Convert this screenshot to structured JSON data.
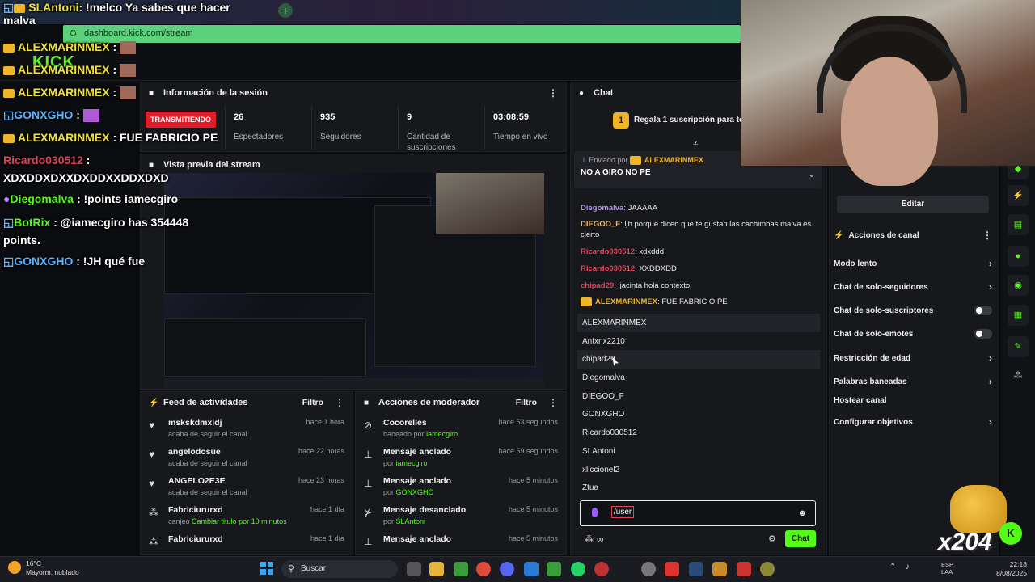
{
  "browser": {
    "url": "dashboard.kick.com/stream",
    "new_tab": "+"
  },
  "kick": {
    "logo": "KICK"
  },
  "session": {
    "title": "Información de la sesión",
    "live_badge": "TRANSMITIENDO",
    "stats": [
      {
        "value": "26",
        "label": "Espectadores"
      },
      {
        "value": "935",
        "label": "Seguidores"
      },
      {
        "value": "9",
        "label": "Cantidad de suscripciones"
      },
      {
        "value": "03:08:59",
        "label": "Tiempo en vivo"
      }
    ]
  },
  "preview": {
    "title": "Vista previa del stream"
  },
  "feed": {
    "title": "Feed de actividades",
    "filter": "Filtro",
    "items": [
      {
        "icon": "heart-icon",
        "name": "mskskdmxidj",
        "detail": "acaba de seguir el canal",
        "time": "hace 1 hora"
      },
      {
        "icon": "heart-icon",
        "name": "angelodosue",
        "detail": "acaba de seguir el canal",
        "time": "hace 22 horas"
      },
      {
        "icon": "heart-icon",
        "name": "ANGELO2E3E",
        "detail": "acaba de seguir el canal",
        "time": "hace 23 horas"
      },
      {
        "icon": "points-icon",
        "name": "Fabriciururxd",
        "detail_prefix": "canjeó",
        "detail_hl": "Cambiar titulo por 10 minutos",
        "time": "hace 1 día"
      },
      {
        "icon": "points-icon",
        "name": "Fabriciururxd",
        "detail": "",
        "time": "hace 1 día"
      }
    ]
  },
  "mod": {
    "title": "Acciones de moderador",
    "filter": "Filtro",
    "items": [
      {
        "icon": "ban-icon",
        "name": "Cocorelles",
        "prefix": "baneado por",
        "by": "iamecgiro",
        "time": "hace 53 segundos"
      },
      {
        "icon": "pin-icon",
        "name": "Mensaje anclado",
        "prefix": "por",
        "by": "iamecgiro",
        "time": "hace 59 segundos"
      },
      {
        "icon": "pin-icon",
        "name": "Mensaje anclado",
        "prefix": "por",
        "by": "GONXGHO",
        "time": "hace 5 minutos"
      },
      {
        "icon": "unpin-icon",
        "name": "Mensaje desanclado",
        "prefix": "por",
        "by": "SLAntoni",
        "time": "hace 5 minutos"
      },
      {
        "icon": "pin-icon",
        "name": "Mensaje anclado",
        "prefix": "",
        "by": "",
        "time": "hace 5 minutos"
      }
    ]
  },
  "chat": {
    "title": "Chat",
    "sub_promo": "Regala 1 suscripción para tomar",
    "sub_count": "1",
    "pinned": {
      "by_label": "Enviado por",
      "by_user": "ALEXMARINMEX",
      "message": "NO A GIRO NO PE"
    },
    "messages": [
      {
        "user": "Diegomalva",
        "color": "#b58cf6",
        "text": "JAAAAA"
      },
      {
        "user": "DIEGOO_F",
        "color": "#e7b86a",
        "text": "ljh porque dicen que te gustan las cachimbas malva es cierto"
      },
      {
        "user": "Ricardo030512",
        "color": "#e0455a",
        "text": "xdxddd"
      },
      {
        "user": "Ricardo030512",
        "color": "#e0455a",
        "text": "XXDDXDD"
      },
      {
        "user": "chipad29",
        "color": "#e0455a",
        "text": "ljacinta hola contexto"
      },
      {
        "user": "ALEXMARINMEX",
        "color": "#f0b429",
        "text": "FUE FABRICIO PE"
      }
    ],
    "suggestions": [
      "ALEXMARINMEX",
      "Antxnx2210",
      "chipad29",
      "Diegomalva",
      "DIEGOO_F",
      "GONXGHO",
      "Ricardo030512",
      "SLAntoni",
      "xliccionel2",
      "Ztua"
    ],
    "input_value": "/user",
    "send": "Chat"
  },
  "channel": {
    "edit": "Editar",
    "title": "Acciones de canal",
    "items": [
      {
        "label": "Modo lento",
        "type": "chevron"
      },
      {
        "label": "Chat de solo-seguidores",
        "type": "chevron"
      },
      {
        "label": "Chat de solo-suscriptores",
        "type": "toggle"
      },
      {
        "label": "Chat de solo-emotes",
        "type": "toggle"
      },
      {
        "label": "Restricción de edad",
        "type": "chevron"
      },
      {
        "label": "Palabras baneadas",
        "type": "chevron"
      },
      {
        "label": "Hostear canal",
        "type": "none"
      },
      {
        "label": "Configurar objetivos",
        "type": "chevron"
      }
    ]
  },
  "overlay": {
    "lines": [
      {
        "user": "SLAntoni",
        "text": ": !melco Ya sabes que hacer malva"
      },
      {
        "user": "ALEXMARINMEX",
        "text": ":"
      },
      {
        "user": "ALEXMARINMEX",
        "text": ":"
      },
      {
        "user": "ALEXMARINMEX",
        "text": ":"
      },
      {
        "user": "GONXGHO",
        "text": ":"
      },
      {
        "user": "ALEXMARINMEX",
        "text": ": FUE FABRICIO PE"
      },
      {
        "user": "Ricardo030512",
        "text": ":"
      },
      {
        "user": "",
        "text": "XDXDDXDXXDXDDXXDDXDXD"
      },
      {
        "user": "Diegomalva",
        "text": ": !points iamecgiro"
      },
      {
        "user": "BotRix",
        "text": ": @iamecgiro has 354448 points."
      },
      {
        "user": "GONXGHO",
        "text": ": !JH qué fue"
      }
    ],
    "x204": "x204"
  },
  "taskbar": {
    "weather_temp": "16°C",
    "weather_desc": "Mayorm. nublado",
    "search": "Buscar",
    "lang1": "ESP",
    "lang2": "LAA",
    "time": "22:18",
    "date": "8/08/2025"
  }
}
